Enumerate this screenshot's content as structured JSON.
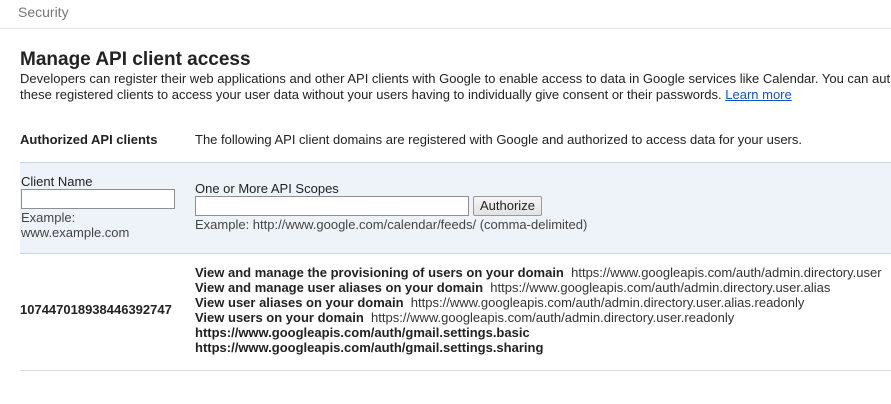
{
  "breadcrumb": "Security",
  "page": {
    "title": "Manage API client access",
    "description_line1": "Developers can register their web applications and other API clients with Google to enable access to data in Google services like Calendar. You can aut",
    "description_line2": "these registered clients to access your user data without your users having to individually give consent or their passwords.",
    "learn_more": "Learn more"
  },
  "authorized": {
    "label": "Authorized API clients",
    "description": "The following API client domains are registered with Google and authorized to access data for your users."
  },
  "form": {
    "client_name_label": "Client Name",
    "client_name_value": "",
    "client_name_example_line1": "Example:",
    "client_name_example_line2": "www.example.com",
    "scopes_label": "One or More API Scopes",
    "scopes_value": "",
    "scopes_example": "Example: http://www.google.com/calendar/feeds/ (comma-delimited)",
    "authorize_button": "Authorize"
  },
  "clients": [
    {
      "id": "107447018938446392747",
      "scopes": [
        {
          "name": "View and manage the provisioning of users on your domain",
          "url": "https://www.googleapis.com/auth/admin.directory.user"
        },
        {
          "name": "View and manage user aliases on your domain",
          "url": "https://www.googleapis.com/auth/admin.directory.user.alias"
        },
        {
          "name": "View user aliases on your domain",
          "url": "https://www.googleapis.com/auth/admin.directory.user.alias.readonly"
        },
        {
          "name": "View users on your domain",
          "url": "https://www.googleapis.com/auth/admin.directory.user.readonly"
        },
        {
          "name": "https://www.googleapis.com/auth/gmail.settings.basic",
          "url": ""
        },
        {
          "name": "https://www.googleapis.com/auth/gmail.settings.sharing",
          "url": ""
        }
      ]
    }
  ]
}
